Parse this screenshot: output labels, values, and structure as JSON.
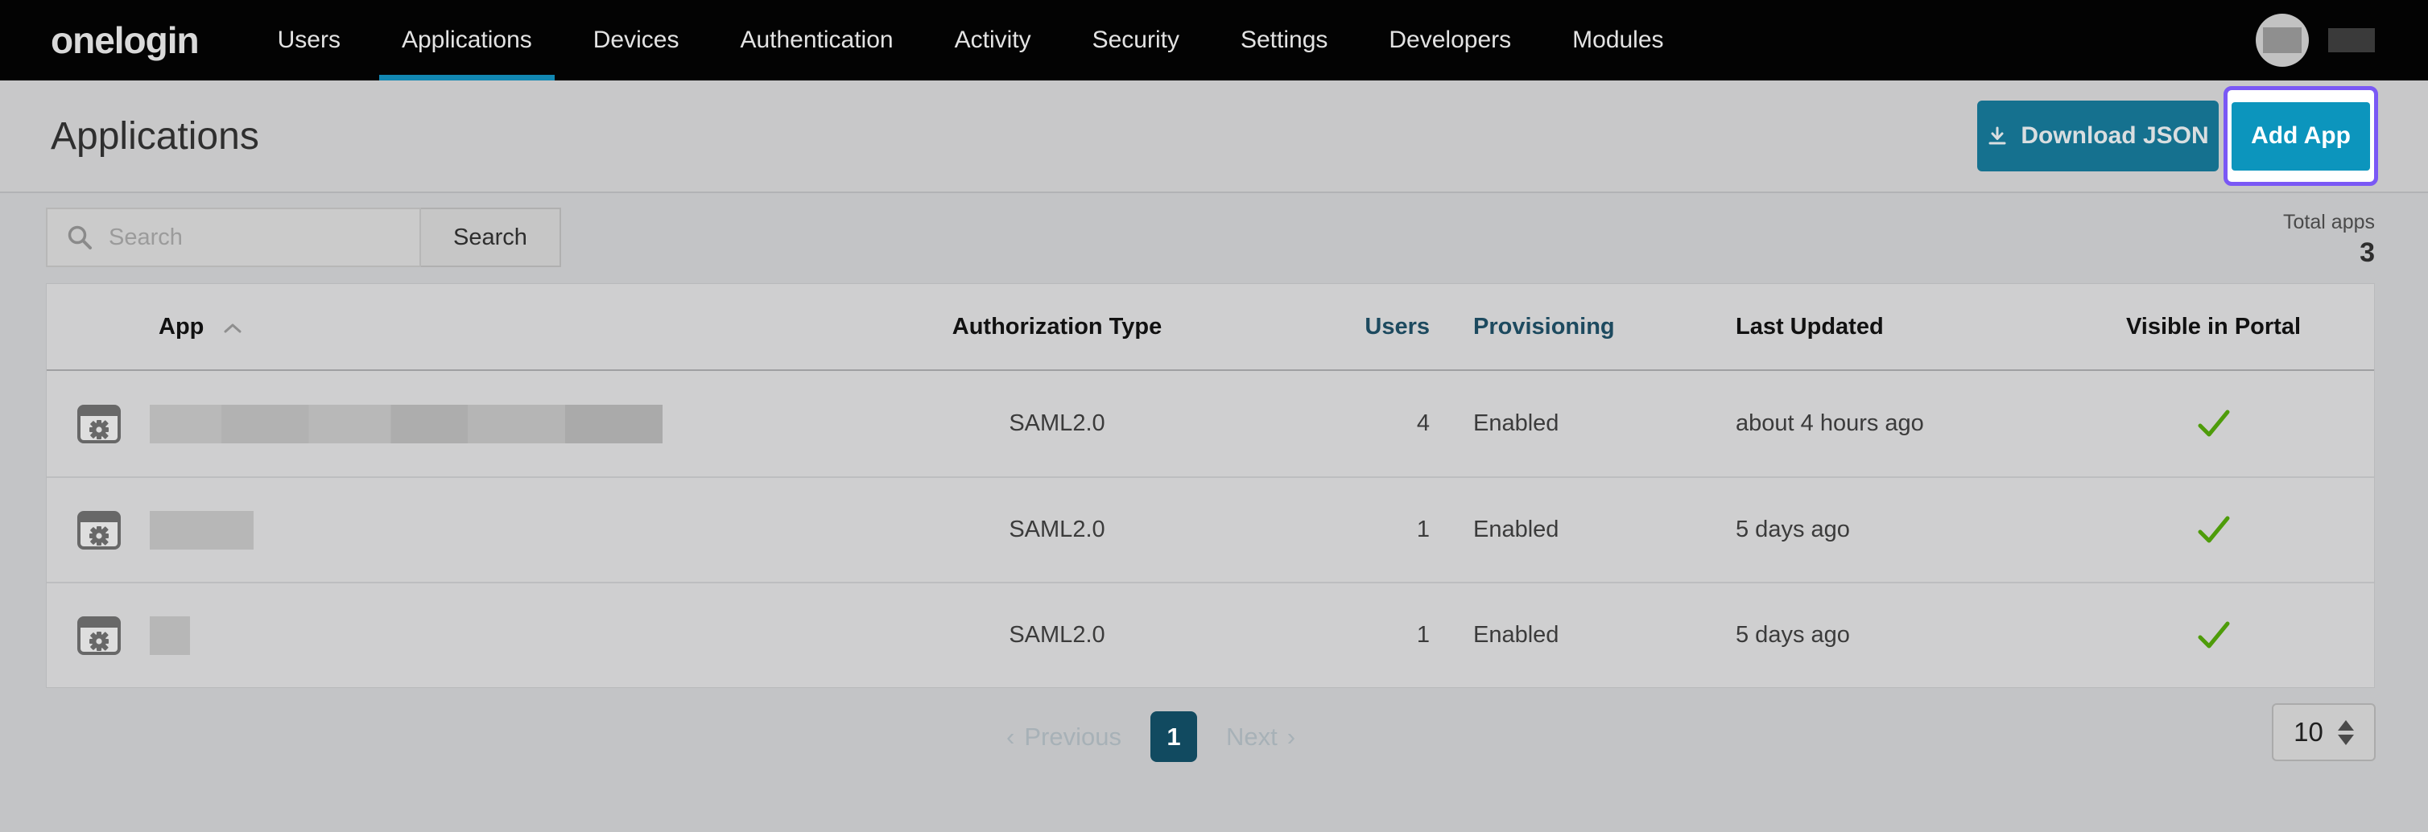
{
  "nav": {
    "logo": "onelogin",
    "items": [
      {
        "label": "Users",
        "active": false
      },
      {
        "label": "Applications",
        "active": true
      },
      {
        "label": "Devices",
        "active": false
      },
      {
        "label": "Authentication",
        "active": false
      },
      {
        "label": "Activity",
        "active": false
      },
      {
        "label": "Security",
        "active": false
      },
      {
        "label": "Settings",
        "active": false
      },
      {
        "label": "Developers",
        "active": false
      },
      {
        "label": "Modules",
        "active": false
      }
    ]
  },
  "header": {
    "title": "Applications",
    "download_button": "Download JSON",
    "add_app_button": "Add App"
  },
  "search": {
    "placeholder": "Search",
    "value": "",
    "button": "Search"
  },
  "summary": {
    "label": "Total apps",
    "count": "3"
  },
  "table": {
    "columns": {
      "app": "App",
      "auth_type": "Authorization Type",
      "users": "Users",
      "provisioning": "Provisioning",
      "last_updated": "Last Updated",
      "visible": "Visible in Portal"
    },
    "sort": {
      "column": "App",
      "direction": "ascending"
    },
    "rows": [
      {
        "app_name": "",
        "name_redacted": true,
        "auth_type": "SAML2.0",
        "users": "4",
        "provisioning": "Enabled",
        "last_updated": "about 4 hours ago",
        "visible_in_portal": true
      },
      {
        "app_name": "",
        "name_redacted": true,
        "auth_type": "SAML2.0",
        "users": "1",
        "provisioning": "Enabled",
        "last_updated": "5 days ago",
        "visible_in_portal": true
      },
      {
        "app_name": "",
        "name_redacted": true,
        "auth_type": "SAML2.0",
        "users": "1",
        "provisioning": "Enabled",
        "last_updated": "5 days ago",
        "visible_in_portal": true
      }
    ]
  },
  "pagination": {
    "previous_label": "Previous",
    "next_label": "Next",
    "current_page": "1",
    "page_size": "10"
  },
  "colors": {
    "accent": "#1287b2",
    "button_teal": "#15718f",
    "add_app_teal": "#0c95bd",
    "pagination_active": "#114a60",
    "check_green": "#4e9c0a",
    "highlight_purple": "#7a58f5",
    "header_link": "#1d4a5f",
    "band_bg": "#c8c8c9",
    "content_bg": "#c3c4c6"
  }
}
